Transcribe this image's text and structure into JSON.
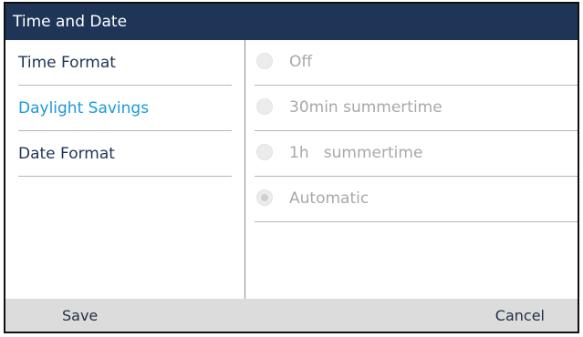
{
  "title": "Time and Date",
  "menu": {
    "items": [
      {
        "label": "Time Format",
        "active": false
      },
      {
        "label": "Daylight Savings",
        "active": true
      },
      {
        "label": "Date Format",
        "active": false
      }
    ]
  },
  "options": {
    "items": [
      {
        "label": "Off",
        "selected": false
      },
      {
        "label": "30min summertime",
        "selected": false
      },
      {
        "label": "1h   summertime",
        "selected": false
      },
      {
        "label": "Automatic",
        "selected": true
      }
    ]
  },
  "softkeys": {
    "save_label": "Save",
    "cancel_label": "Cancel"
  },
  "colors": {
    "titlebar": "#1e3557",
    "active_menu": "#1a9ad8",
    "menu_text": "#1e3557",
    "option_text_disabled": "#a8a8a8",
    "softkey_bar": "#dcdcdc"
  }
}
